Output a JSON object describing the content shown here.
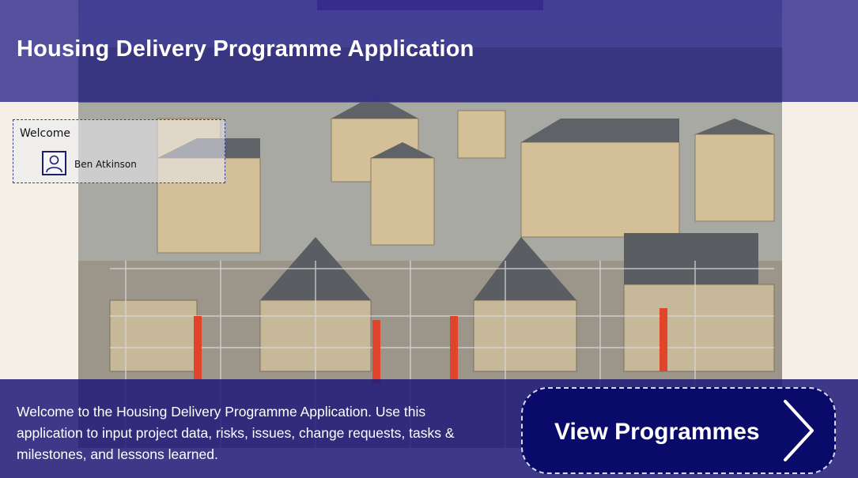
{
  "header": {
    "title": "Housing Delivery Programme Application"
  },
  "welcome": {
    "label": "Welcome",
    "user_name": "Ben Atkinson",
    "avatar_icon": "user-icon"
  },
  "footer": {
    "intro_text": "Welcome to the Housing Delivery Programme Application. Use this application to input project data, risks, issues, change requests, tasks & milestones, and lessons learned.",
    "view_button_label": "View Programmes",
    "view_button_icon": "chevron-right-icon"
  },
  "colors": {
    "header_band": "#2c288c",
    "button_bg": "#0a0a6b",
    "page_bg": "#f5efe6",
    "accent": "#5a2a82"
  }
}
